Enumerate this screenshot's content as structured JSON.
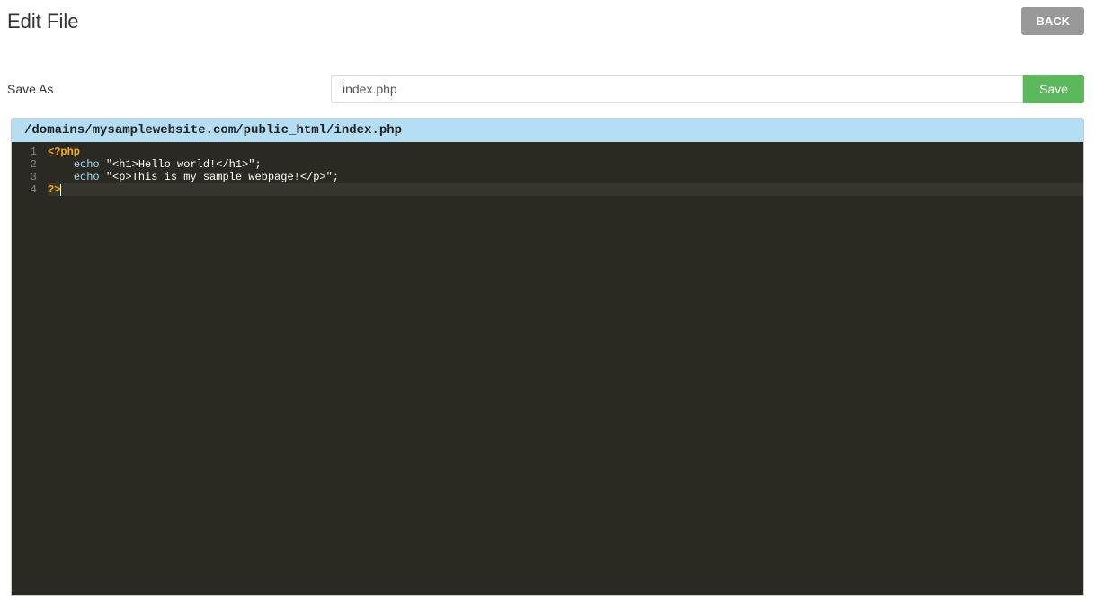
{
  "header": {
    "title": "Edit File",
    "back_label": "BACK"
  },
  "save_row": {
    "label": "Save As",
    "filename_value": "index.php",
    "save_label": "Save"
  },
  "editor": {
    "file_path": "/domains/mysamplewebsite.com/public_html/index.php",
    "line_numbers": [
      "1",
      "2",
      "3",
      "4"
    ],
    "active_line": 4,
    "code_lines": [
      {
        "tokens": [
          {
            "cls": "tok-php-tag",
            "text": "<?php"
          }
        ]
      },
      {
        "tokens": [
          {
            "cls": "tok-default",
            "text": "    "
          },
          {
            "cls": "tok-keyword",
            "text": "echo"
          },
          {
            "cls": "tok-default",
            "text": " "
          },
          {
            "cls": "tok-string",
            "text": "\"<h1>Hello world!</h1>\""
          },
          {
            "cls": "tok-punct",
            "text": ";"
          }
        ]
      },
      {
        "tokens": [
          {
            "cls": "tok-default",
            "text": "    "
          },
          {
            "cls": "tok-keyword",
            "text": "echo"
          },
          {
            "cls": "tok-default",
            "text": " "
          },
          {
            "cls": "tok-string",
            "text": "\"<p>This is my sample webpage!</p>\""
          },
          {
            "cls": "tok-punct",
            "text": ";"
          }
        ]
      },
      {
        "tokens": [
          {
            "cls": "tok-php-tag",
            "text": "?>"
          }
        ]
      }
    ]
  }
}
